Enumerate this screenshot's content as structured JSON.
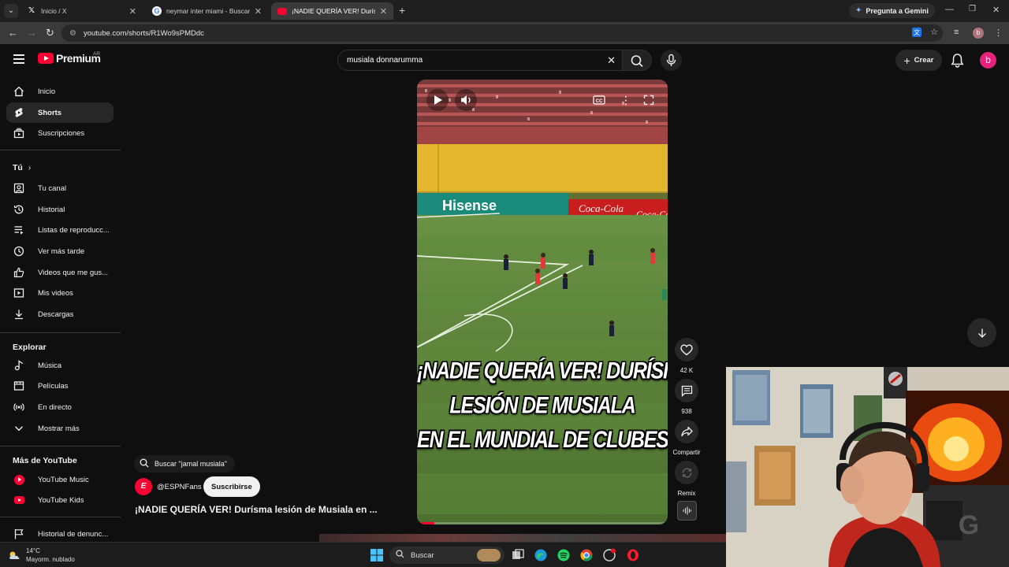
{
  "browser": {
    "tabs": [
      {
        "title": "Inicio / X",
        "favicon": "x-icon",
        "active": false
      },
      {
        "title": "neymar inter miami - Buscar con",
        "favicon": "google-icon",
        "active": false
      },
      {
        "title": "¡NADIE QUERÍA VER! Durísma le",
        "favicon": "youtube-icon",
        "active": true
      }
    ],
    "gemini_button": "Pregunta a Gemini",
    "url": "youtube.com/shorts/R1Wo9sPMDdc",
    "profile_initial": "b"
  },
  "youtube": {
    "logo_text": "Premium",
    "region": "AR",
    "search": {
      "value": "musiala donnarumma"
    },
    "create_label": "Crear",
    "avatar_initial": "b",
    "sidebar": {
      "main": [
        {
          "label": "Inicio",
          "icon": "home-icon"
        },
        {
          "label": "Shorts",
          "icon": "shorts-icon",
          "active": true
        },
        {
          "label": "Suscripciones",
          "icon": "subscriptions-icon"
        }
      ],
      "you_header": "Tú",
      "you": [
        {
          "label": "Tu canal",
          "icon": "channel-icon"
        },
        {
          "label": "Historial",
          "icon": "history-icon"
        },
        {
          "label": "Listas de reproducc...",
          "icon": "playlists-icon"
        },
        {
          "label": "Ver más tarde",
          "icon": "watch-later-icon"
        },
        {
          "label": "Videos que me gus...",
          "icon": "liked-icon"
        },
        {
          "label": "Mis videos",
          "icon": "my-videos-icon"
        },
        {
          "label": "Descargas",
          "icon": "downloads-icon"
        }
      ],
      "explore_header": "Explorar",
      "explore": [
        {
          "label": "Música",
          "icon": "music-icon"
        },
        {
          "label": "Películas",
          "icon": "movies-icon"
        },
        {
          "label": "En directo",
          "icon": "live-icon"
        },
        {
          "label": "Mostrar más",
          "icon": "chevron-down-icon"
        }
      ],
      "more_header": "Más de YouTube",
      "more": [
        {
          "label": "YouTube Music",
          "icon": "youtube-music-icon"
        },
        {
          "label": "YouTube Kids",
          "icon": "youtube-kids-icon"
        },
        {
          "label": "Historial de denunc...",
          "icon": "flag-icon"
        }
      ]
    },
    "short": {
      "overlay_lines": [
        "¡NADIE QUERÍA VER! DURÍSIMA",
        "LESIÓN DE MUSIALA",
        "EN EL MUNDIAL DE CLUBES"
      ],
      "sponsor_boards": [
        "Hisense",
        "Coca-Cola",
        "Coca-Cola"
      ],
      "progress": 0.07,
      "search_chip": "Buscar \"jamal musiala\"",
      "channel": "@ESPNFans",
      "channel_logo_letter": "E",
      "subscribe_label": "Suscribirse",
      "title": "¡NADIE QUERÍA VER! Durísma lesión de Musiala en ...",
      "likes": "42 K",
      "comments": "938",
      "share_label": "Compartir",
      "remix_label": "Remix"
    }
  },
  "taskbar": {
    "temperature": "14°C",
    "weather": "Mayorm. nublado",
    "search_placeholder": "Buscar"
  },
  "colors": {
    "accent": "#ff0033",
    "background": "#0f0f0f",
    "pitch": "#557a35",
    "avatar": "#e5227c"
  }
}
